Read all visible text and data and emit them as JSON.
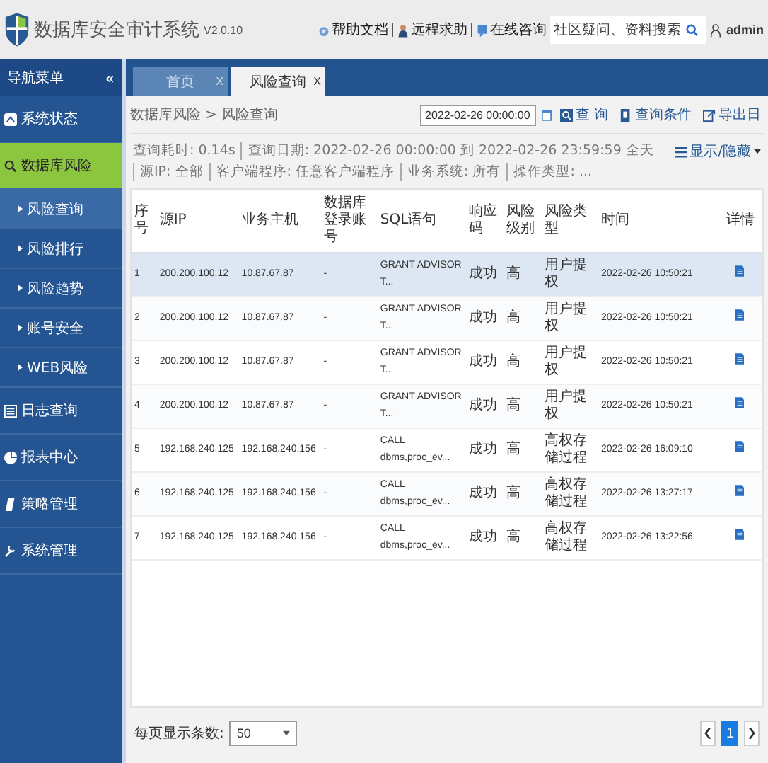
{
  "header": {
    "title": "数据库安全审计系统",
    "version": "V2.0.10",
    "links": [
      "帮助文档",
      "远程求助",
      "在线咨询"
    ],
    "search": {
      "placeholder": "社区疑问、资料搜索"
    },
    "user": "admin"
  },
  "sidebar": {
    "title": "导航菜单",
    "collapse": "«",
    "items": [
      {
        "label": "系统状态",
        "selected": false
      },
      {
        "label": "数据库风险",
        "selected": true,
        "expanded": true,
        "children": [
          {
            "label": "风险查询",
            "selected": true
          },
          {
            "label": "风险排行",
            "selected": false
          },
          {
            "label": "风险趋势",
            "selected": false
          },
          {
            "label": "账号安全",
            "selected": false
          },
          {
            "label": "WEB风险",
            "selected": false
          }
        ]
      },
      {
        "label": "日志查询",
        "selected": false
      },
      {
        "label": "报表中心",
        "selected": false
      },
      {
        "label": "策略管理",
        "selected": false
      },
      {
        "label": "系统管理",
        "selected": false
      }
    ]
  },
  "tabs": [
    {
      "label": "首页",
      "close": "X",
      "selected": false
    },
    {
      "label": "风险查询",
      "close": "X",
      "selected": true
    }
  ],
  "breadcrumb": "数据库风险 > 风险查询",
  "toolbar": {
    "date": "2022-02-26 00:00:00",
    "buttons": [
      "查 询",
      "查询条件",
      "导出日"
    ]
  },
  "filters": [
    "查询耗时: 0.14s",
    "查询日期: 2022-02-26 00:00:00 到 2022-02-26 23:59:59 全天",
    "源IP: 全部",
    "客户端程序: 任意客户端程序",
    "业务系统: 所有",
    "操作类型: ..."
  ],
  "toggle_columns": "显示/隐藏",
  "table": {
    "columns": [
      "序号",
      "源IP",
      "业务主机",
      "数据库登录账号",
      "SQL语句",
      "响应码",
      "风险级别",
      "风险类型",
      "时间",
      "详情"
    ],
    "rows": [
      {
        "selected": true,
        "cells": [
          "1",
          "200.200.100.12",
          "10.87.67.87",
          "-",
          "GRANT ADVISOR T...",
          "成功",
          "高",
          "用户提权",
          "2022-02-26 10:50:21"
        ]
      },
      {
        "selected": false,
        "cells": [
          "2",
          "200.200.100.12",
          "10.87.67.87",
          "-",
          "GRANT ADVISOR T...",
          "成功",
          "高",
          "用户提权",
          "2022-02-26 10:50:21"
        ]
      },
      {
        "selected": false,
        "cells": [
          "3",
          "200.200.100.12",
          "10.87.67.87",
          "-",
          "GRANT ADVISOR T...",
          "成功",
          "高",
          "用户提权",
          "2022-02-26 10:50:21"
        ]
      },
      {
        "selected": false,
        "cells": [
          "4",
          "200.200.100.12",
          "10.87.67.87",
          "-",
          "GRANT ADVISOR T...",
          "成功",
          "高",
          "用户提权",
          "2022-02-26 10:50:21"
        ]
      },
      {
        "selected": false,
        "cells": [
          "5",
          "192.168.240.125",
          "192.168.240.156",
          "-",
          "CALL dbms,proc_ev...",
          "成功",
          "高",
          "高权存储过程",
          "2022-02-26 16:09:10"
        ]
      },
      {
        "selected": false,
        "cells": [
          "6",
          "192.168.240.125",
          "192.168.240.156",
          "-",
          "CALL dbms,proc_ev...",
          "成功",
          "高",
          "高权存储过程",
          "2022-02-26 13:27:17"
        ]
      },
      {
        "selected": false,
        "cells": [
          "7",
          "192.168.240.125",
          "192.168.240.156",
          "-",
          "CALL dbms,proc_ev...",
          "成功",
          "高",
          "高权存储过程",
          "2022-02-26 13:22:56"
        ]
      }
    ]
  },
  "footer": {
    "page_size_label": "每页显示条数:",
    "page_size": "50",
    "pages": [
      {
        "label": "1",
        "selected": true
      }
    ]
  }
}
